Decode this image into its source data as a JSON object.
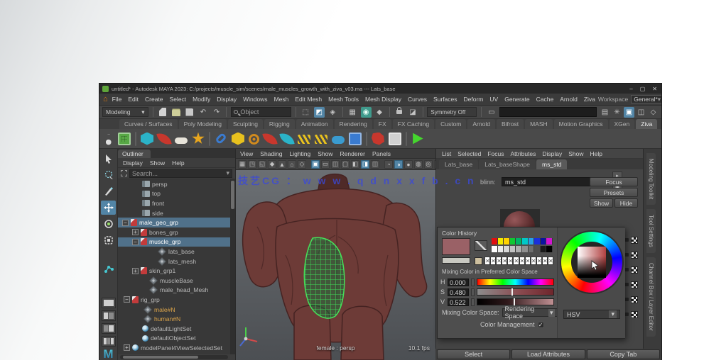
{
  "window": {
    "title": "untitled* - Autodesk MAYA 2023: C:/projects/muscle_sim/scenes/male_muscles_growth_with_ziva_v03.ma --- Lats_base",
    "controls": {
      "min": "–",
      "max": "▢",
      "close": "✕"
    }
  },
  "icons": {
    "arrow": "▾",
    "home": "⌂",
    "undo": "↶",
    "redo": "↷",
    "right": "▸",
    "check": "✓",
    "x": "✕",
    "box": "▣"
  },
  "menubar": {
    "items": [
      "File",
      "Edit",
      "Create",
      "Select",
      "Modify",
      "Display",
      "Windows",
      "Mesh",
      "Edit Mesh",
      "Mesh Tools",
      "Mesh Display",
      "Curves",
      "Surfaces",
      "Deform",
      "UV",
      "Generate",
      "Cache",
      "Arnold",
      "Ziva"
    ],
    "workspace_label": "Workspace",
    "workspace_value": "General*"
  },
  "statusbar": {
    "mode": "Modeling",
    "name_filter": "Object",
    "symmetry": "Symmetry Off"
  },
  "shelf": {
    "tabs": [
      {
        "label": "Curves / Surfaces",
        "cls": ""
      },
      {
        "label": "Poly Modeling",
        "cls": ""
      },
      {
        "label": "Sculpting",
        "cls": ""
      },
      {
        "label": "Rigging",
        "cls": ""
      },
      {
        "label": "Animation",
        "cls": ""
      },
      {
        "label": "Rendering",
        "cls": ""
      },
      {
        "label": "FX",
        "cls": ""
      },
      {
        "label": "FX Caching",
        "cls": ""
      },
      {
        "label": "Custom",
        "cls": ""
      },
      {
        "label": "Arnold",
        "cls": ""
      },
      {
        "label": "Bifrost",
        "cls": ""
      },
      {
        "label": "MASH",
        "cls": ""
      },
      {
        "label": "Motion Graphics",
        "cls": ""
      },
      {
        "label": "XGen",
        "cls": ""
      },
      {
        "label": "Ziva",
        "cls": "active"
      }
    ],
    "icons": [
      {
        "s": "panel grid",
        "c": "#57a845"
      },
      {
        "s": "sep",
        "c": ""
      },
      {
        "s": "cube",
        "c": "#2bb3c8"
      },
      {
        "s": "leaf",
        "c": "#c8372d"
      },
      {
        "s": "bone",
        "c": "#e8e4da"
      },
      {
        "s": "star",
        "c": "#e8a61e"
      },
      {
        "s": "sep",
        "c": ""
      },
      {
        "s": "link",
        "c": "#3a7bd0"
      },
      {
        "s": "cube",
        "c": "#e8c11e"
      },
      {
        "s": "rope",
        "c": "#d08a1e"
      },
      {
        "s": "leaf",
        "c": "#c8372d"
      },
      {
        "s": "leaf",
        "c": "#2bb3c8"
      },
      {
        "s": "curve",
        "c": "#e8c11e"
      },
      {
        "s": "curve",
        "c": "#e8c11e"
      },
      {
        "s": "pill",
        "c": "#3a9bd0"
      },
      {
        "s": "panel",
        "c": "#3a7bd0"
      },
      {
        "s": "sep",
        "c": ""
      },
      {
        "s": "flag",
        "c": "#c8372d"
      },
      {
        "s": "panel",
        "c": "#d0d0d0"
      },
      {
        "s": "sep",
        "c": ""
      },
      {
        "s": "play",
        "c": "#45d62e"
      }
    ]
  },
  "outliner": {
    "tab": "Outliner",
    "menus": [
      "Display",
      "Show",
      "Help"
    ],
    "search_placeholder": "Search...",
    "items": [
      {
        "label": "persp",
        "ico": "cam",
        "pad": "22px",
        "tog": "",
        "cls": ""
      },
      {
        "label": "top",
        "ico": "cam",
        "pad": "22px",
        "tog": "",
        "cls": ""
      },
      {
        "label": "front",
        "ico": "cam",
        "pad": "22px",
        "tog": "",
        "cls": ""
      },
      {
        "label": "side",
        "ico": "cam",
        "pad": "22px",
        "tog": "",
        "cls": ""
      },
      {
        "label": "male_geo_grp",
        "ico": "grp",
        "pad": "6px",
        "tog": "−",
        "cls": "sel"
      },
      {
        "label": "bones_grp",
        "ico": "grp",
        "pad": "20px",
        "tog": "+",
        "cls": ""
      },
      {
        "label": "muscle_grp",
        "ico": "grp",
        "pad": "20px",
        "tog": "−",
        "cls": "sel"
      },
      {
        "label": "lats_base",
        "ico": "mesh",
        "pad": "44px",
        "tog": "",
        "cls": ""
      },
      {
        "label": "lats_mesh",
        "ico": "mesh",
        "pad": "44px",
        "tog": "",
        "cls": ""
      },
      {
        "label": "skin_grp1",
        "ico": "grp",
        "pad": "20px",
        "tog": "+",
        "cls": ""
      },
      {
        "label": "muscleBase",
        "ico": "mesh",
        "pad": "32px",
        "tog": "",
        "cls": ""
      },
      {
        "label": "male_head_Mesh",
        "ico": "mesh",
        "pad": "32px",
        "tog": "",
        "cls": ""
      },
      {
        "label": "rig_grp",
        "ico": "grp",
        "pad": "8px",
        "tog": "−",
        "cls": ""
      },
      {
        "label": "male#N",
        "ico": "mesh",
        "pad": "24px",
        "tog": "",
        "cls": "ref"
      },
      {
        "label": "human#N",
        "ico": "mesh",
        "pad": "24px",
        "tog": "",
        "cls": "ref"
      },
      {
        "label": "defaultLightSet",
        "ico": "set",
        "pad": "22px",
        "tog": "",
        "cls": ""
      },
      {
        "label": "defaultObjectSet",
        "ico": "set",
        "pad": "22px",
        "tog": "",
        "cls": ""
      },
      {
        "label": "modelPanel4ViewSelectedSet",
        "ico": "set",
        "pad": "8px",
        "tog": "+",
        "cls": ""
      }
    ]
  },
  "viewport": {
    "menus": [
      "View",
      "Shading",
      "Lighting",
      "Show",
      "Renderer",
      "Panels"
    ],
    "icons": [
      {
        "g": "▦",
        "cls": ""
      },
      {
        "g": "◳",
        "cls": ""
      },
      {
        "g": "◱",
        "cls": ""
      },
      {
        "g": "◆",
        "cls": ""
      },
      {
        "g": "▲",
        "cls": ""
      },
      {
        "g": "⌂",
        "cls": ""
      },
      {
        "g": "◇",
        "cls": ""
      },
      {
        "g": "",
        "cls": "sp"
      },
      {
        "g": "▣",
        "cls": "on"
      },
      {
        "g": "▭",
        "cls": ""
      },
      {
        "g": "◫",
        "cls": ""
      },
      {
        "g": "▢",
        "cls": ""
      },
      {
        "g": "◧",
        "cls": ""
      },
      {
        "g": "◨",
        "cls": "on"
      },
      {
        "g": "◫",
        "cls": ""
      },
      {
        "g": "",
        "cls": "sp"
      },
      {
        "g": "◔",
        "cls": ""
      },
      {
        "g": "◑",
        "cls": "on"
      },
      {
        "g": "●",
        "cls": ""
      },
      {
        "g": "◍",
        "cls": ""
      },
      {
        "g": "◎",
        "cls": ""
      },
      {
        "g": "✳",
        "cls": ""
      },
      {
        "g": "●",
        "cls": ""
      }
    ],
    "camera_label": "female : persp",
    "fps": "10.1 fps",
    "watermark": "技艺CG ： w w w . q d n x x f b . c n"
  },
  "attribute_editor": {
    "menus": [
      "List",
      "Selected",
      "Focus",
      "Attributes",
      "Display",
      "Show",
      "Help"
    ],
    "tabs": [
      {
        "label": "Lats_base",
        "cls": ""
      },
      {
        "label": "Lats_baseShape",
        "cls": ""
      },
      {
        "label": "ms_std",
        "cls": "active"
      }
    ],
    "node_type_label": "blinn:",
    "node_name": "ms_std",
    "buttons": {
      "focus": "Focus",
      "presets": "Presets",
      "show": "Show",
      "hide": "Hide"
    },
    "bottom_buttons": [
      "Select",
      "Load Attributes",
      "Copy Tab"
    ]
  },
  "color_editor": {
    "title": "Color History",
    "current_color": "#9a6166",
    "secondary_color": "#c9c9c2",
    "beige_color": "#cdbf9e",
    "palette_row1": [
      "#e01010",
      "#f2ea00",
      "#ffd200",
      "#10c832",
      "#00b464",
      "#00c8c8",
      "#28a0e6",
      "#1a30dc",
      "#0a14a0",
      "#d214d2"
    ],
    "palette_row2": [
      "#ffffff",
      "#ebebeb",
      "#d7d7d7",
      "#c3c3c3",
      "#afafaf",
      "#8f8f8f",
      "#6f6f6f",
      "#4f4f4f",
      "#1a1a1a",
      "#000000"
    ],
    "history": [
      "✕",
      "✕",
      "✕",
      "✕",
      "✕",
      "✕",
      "✕",
      "✕",
      "✕",
      "✕",
      "✕",
      "✕"
    ],
    "mixing_label": "Mixing Color in Preferred Color Space",
    "sliders": [
      {
        "label": "H",
        "value": "0.000",
        "barcls": "hue"
      },
      {
        "label": "S",
        "value": "0.480",
        "barcls": "sat"
      },
      {
        "label": "V",
        "value": "0.522",
        "barcls": "val"
      }
    ],
    "space_label": "Mixing Color Space:",
    "space_value": "Rendering Space",
    "cm_label": "Color Management",
    "wheel_mode": "HSV"
  },
  "right_tabs": [
    "Modeling Toolkit",
    "Tool Settings",
    "Channel Box / Layer Editor"
  ]
}
